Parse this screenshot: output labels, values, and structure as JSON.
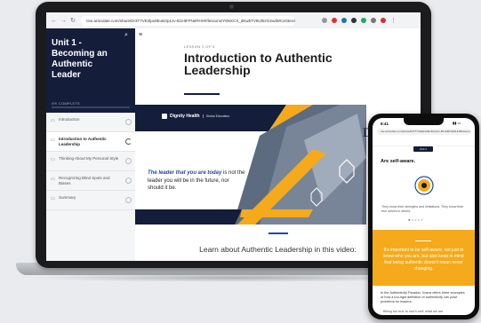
{
  "browser": {
    "url": "rise.articulate.com/share/Dr3T7VE2lpx0Eu5Op1zv-B1HtFFNeRHH#/lessons/Y8NXCX_dKwbTV9Ut0zG3odWCx03ev4",
    "nav_icons": [
      "back-icon",
      "forward-icon",
      "reload-icon"
    ]
  },
  "sidebar": {
    "course_title": "Unit 1 - Becoming an Authentic Leader",
    "progress_label": "0% COMPLETE",
    "progress": 0,
    "items": [
      {
        "label": "Introduction"
      },
      {
        "label": "Introduction to Authentic Leadership"
      },
      {
        "label": "Thinking About My Personal Style"
      },
      {
        "label": "Recognizing Blind Spots and Biases"
      },
      {
        "label": "Summary"
      }
    ]
  },
  "main": {
    "lesson_number": "LESSON 2 OF 5",
    "title": "Introduction to Authentic Leadership",
    "banner": {
      "brand_name": "Dignity Health",
      "brand_sub": "Global Education",
      "partner": "Duke",
      "partner_sup": "CE",
      "quote_emphasis": "The leader that you are today",
      "quote_rest": "is not the leader you will be in the future, nor should it be."
    },
    "learn_heading": "Learn about Authentic Leadership in this video:"
  },
  "phone": {
    "time": "9:41",
    "badge": "Unit 1",
    "heading": "Are self-aware.",
    "caption": "They know their strengths and limitations. They know their true selves in others.",
    "orange_text": "It's important to be self-aware, not just to know who you are, but also keep in mind that being authentic doesn't mean never changing.",
    "body": "In the Authenticity Paradox, Ibarra offers three examples of how a too-rigid definition of authenticity can pose problems for leaders.",
    "last_line": "Being too true to one's self: what we are"
  },
  "colors": {
    "navy": "#141d3a",
    "accent_blue": "#1f4a9c",
    "gold": "#f4aa1a"
  }
}
